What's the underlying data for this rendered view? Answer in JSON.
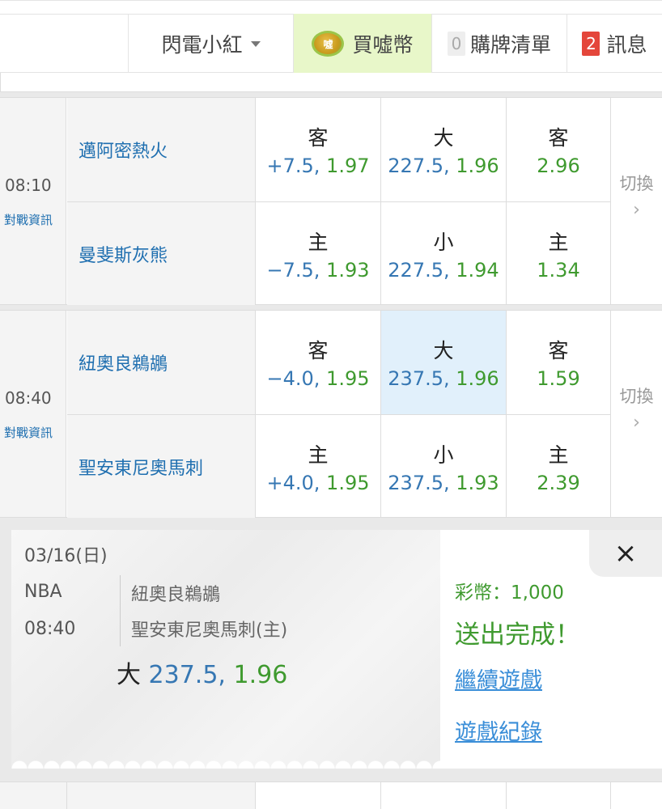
{
  "header": {
    "user_name": "閃電小紅",
    "buy_label": "買噓幣",
    "coin_text": "噓",
    "cart_count": "0",
    "cart_label": "購牌清單",
    "msg_count": "2",
    "msg_label": "訊息"
  },
  "matches": [
    {
      "time": "08:10",
      "info": "對戰資訊",
      "away_team": "邁阿密熱火",
      "home_team": "曼斐斯灰熊",
      "away_spread_label": "客",
      "away_spread": "+7.5,",
      "away_spread_odds": "1.97",
      "over_label": "大",
      "over_line": "227.5,",
      "over_odds": "1.96",
      "away_ml_label": "客",
      "away_ml": "2.96",
      "home_spread_label": "主",
      "home_spread": "−7.5,",
      "home_spread_odds": "1.93",
      "under_label": "小",
      "under_line": "227.5,",
      "under_odds": "1.94",
      "home_ml_label": "主",
      "home_ml": "1.34",
      "switch_label": "切換"
    },
    {
      "time": "08:40",
      "info": "對戰資訊",
      "away_team": "紐奧良鵜鶘",
      "home_team": "聖安東尼奧馬刺",
      "away_spread_label": "客",
      "away_spread": "−4.0,",
      "away_spread_odds": "1.95",
      "over_label": "大",
      "over_line": "237.5,",
      "over_odds": "1.96",
      "away_ml_label": "客",
      "away_ml": "1.59",
      "home_spread_label": "主",
      "home_spread": "+4.0,",
      "home_spread_odds": "1.95",
      "under_label": "小",
      "under_line": "237.5,",
      "under_odds": "1.93",
      "home_ml_label": "主",
      "home_ml": "2.39",
      "switch_label": "切換"
    }
  ],
  "popup": {
    "date": "03/16(日)",
    "league": "NBA",
    "time": "08:40",
    "team1": "紐奧良鵜鶘",
    "team2": "聖安東尼奧馬刺(主)",
    "bet_label": "大",
    "bet_line": "237.5,",
    "bet_odds": "1.96",
    "amount": "彩幣：1,000",
    "done": "送出完成！",
    "continue_link": "繼續遊戲",
    "history_link": "遊戲紀錄",
    "close": "×"
  },
  "icons": {
    "chevron": "›",
    "caret": "caret-down"
  },
  "colors": {
    "team_blue": "#1f6fb0",
    "odds_blue": "#3677b3",
    "odds_green": "#3f9a2f",
    "selected": "#e1f0fb",
    "buy_bg": "#e8f7c9",
    "badge_red": "#e4463b"
  }
}
